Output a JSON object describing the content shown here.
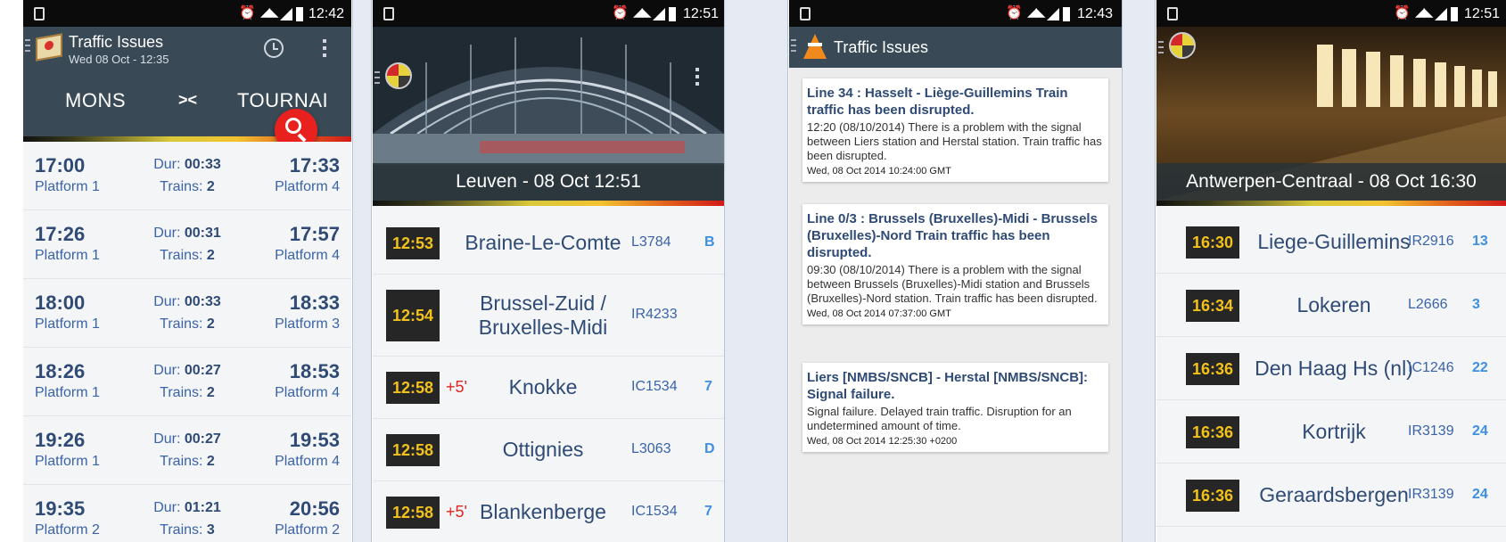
{
  "phone1": {
    "status_time": "12:42",
    "title": "Traffic Issues",
    "subtitle": "Wed 08 Oct - 12:35",
    "from_station": "MONS",
    "swap_symbol": "><",
    "to_station": "TOURNAI",
    "dur_label": "Dur:",
    "trains_label": "Trains:",
    "connections": [
      {
        "dep": "17:00",
        "arr": "17:33",
        "dep_platform": "Platform 1",
        "arr_platform": "Platform 4",
        "duration": "00:33",
        "trains": "2"
      },
      {
        "dep": "17:26",
        "arr": "17:57",
        "dep_platform": "Platform 1",
        "arr_platform": "Platform 4",
        "duration": "00:31",
        "trains": "2"
      },
      {
        "dep": "18:00",
        "arr": "18:33",
        "dep_platform": "Platform 1",
        "arr_platform": "Platform 3",
        "duration": "00:33",
        "trains": "2"
      },
      {
        "dep": "18:26",
        "arr": "18:53",
        "dep_platform": "Platform 1",
        "arr_platform": "Platform 4",
        "duration": "00:27",
        "trains": "2"
      },
      {
        "dep": "19:26",
        "arr": "19:53",
        "dep_platform": "Platform 1",
        "arr_platform": "Platform 4",
        "duration": "00:27",
        "trains": "2"
      },
      {
        "dep": "19:35",
        "arr": "20:56",
        "dep_platform": "Platform 2",
        "arr_platform": "Platform 2",
        "duration": "01:21",
        "trains": "3"
      }
    ]
  },
  "phone2": {
    "status_time": "12:51",
    "caption": "Leuven - 08 Oct 12:51",
    "rows": [
      {
        "time": "12:53",
        "delay": "",
        "dest": "Braine-Le-Comte",
        "train": "L3784",
        "platform": "B"
      },
      {
        "time": "12:54",
        "delay": "",
        "dest": "Brussel-Zuid / Bruxelles-Midi",
        "train": "IR4233",
        "platform": ""
      },
      {
        "time": "12:58",
        "delay": "+5'",
        "dest": "Knokke",
        "train": "IC1534",
        "platform": "7"
      },
      {
        "time": "12:58",
        "delay": "",
        "dest": "Ottignies",
        "train": "L3063",
        "platform": "D"
      },
      {
        "time": "12:58",
        "delay": "+5'",
        "dest": "Blankenberge",
        "train": "IC1534",
        "platform": "7"
      }
    ]
  },
  "phone3": {
    "status_time": "12:43",
    "title": "Traffic Issues",
    "issues": [
      {
        "title": "Line 34 : Hasselt - Liège-Guillemins Train traffic has been disrupted.",
        "body": "12:20 (08/10/2014) There is a problem with the signal between Liers station and Herstal station. Train traffic has been disrupted.",
        "date": "Wed, 08 Oct 2014 10:24:00 GMT"
      },
      {
        "title": "Line 0/3 : Brussels (Bruxelles)-Midi - Brussels (Bruxelles)-Nord Train traffic has been disrupted.",
        "body": "09:30 (08/10/2014) There is a problem with the signal between Brussels (Bruxelles)-Midi station and Brussels (Bruxelles)-Nord station. Train traffic has been disrupted.",
        "date": "Wed, 08 Oct 2014 07:37:00 GMT"
      },
      {
        "title": "Liers [NMBS/SNCB] - Herstal [NMBS/SNCB]: Signal failure.",
        "body": "Signal failure. Delayed train traffic. Disruption for an undetermined amount of time.",
        "date": "Wed, 08 Oct 2014 12:25:30 +0200"
      }
    ]
  },
  "phone4": {
    "status_time": "12:51",
    "caption": "Antwerpen-Centraal - 08 Oct 16:30",
    "rows": [
      {
        "time": "16:30",
        "dest": "Liege-Guillemins",
        "train": "IR2916",
        "platform": "13"
      },
      {
        "time": "16:34",
        "dest": "Lokeren",
        "train": "L2666",
        "platform": "3"
      },
      {
        "time": "16:36",
        "dest": "Den Haag Hs (nl)",
        "train": "IC1246",
        "platform": "22"
      },
      {
        "time": "16:36",
        "dest": "Kortrijk",
        "train": "IR3139",
        "platform": "24"
      },
      {
        "time": "16:36",
        "dest": "Geraardsbergen",
        "train": "IR3139",
        "platform": "24"
      }
    ]
  }
}
